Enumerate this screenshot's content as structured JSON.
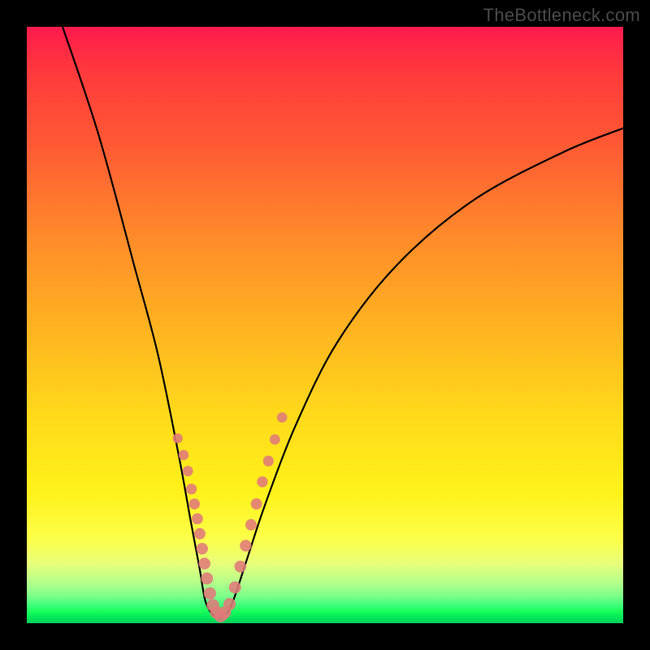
{
  "watermark": "TheBottleneck.com",
  "chart_data": {
    "type": "line",
    "title": "",
    "xlabel": "",
    "ylabel": "",
    "xlim": [
      0,
      1
    ],
    "ylim": [
      0,
      1
    ],
    "series": [
      {
        "name": "bottleneck-curve",
        "points": [
          [
            0.06,
            1.0
          ],
          [
            0.12,
            0.82
          ],
          [
            0.18,
            0.6
          ],
          [
            0.22,
            0.45
          ],
          [
            0.255,
            0.28
          ],
          [
            0.275,
            0.17
          ],
          [
            0.29,
            0.09
          ],
          [
            0.3,
            0.035
          ],
          [
            0.315,
            0.012
          ],
          [
            0.33,
            0.012
          ],
          [
            0.345,
            0.035
          ],
          [
            0.37,
            0.11
          ],
          [
            0.4,
            0.2
          ],
          [
            0.45,
            0.33
          ],
          [
            0.52,
            0.47
          ],
          [
            0.62,
            0.6
          ],
          [
            0.75,
            0.71
          ],
          [
            0.9,
            0.79
          ],
          [
            1.0,
            0.83
          ]
        ]
      },
      {
        "name": "highlight-dots",
        "points": [
          [
            0.253,
            0.31
          ],
          [
            0.263,
            0.282
          ],
          [
            0.27,
            0.255
          ],
          [
            0.276,
            0.225
          ],
          [
            0.281,
            0.2
          ],
          [
            0.286,
            0.175
          ],
          [
            0.29,
            0.15
          ],
          [
            0.294,
            0.125
          ],
          [
            0.298,
            0.1
          ],
          [
            0.302,
            0.075
          ],
          [
            0.307,
            0.05
          ],
          [
            0.312,
            0.03
          ],
          [
            0.318,
            0.018
          ],
          [
            0.325,
            0.012
          ],
          [
            0.332,
            0.018
          ],
          [
            0.34,
            0.032
          ],
          [
            0.349,
            0.06
          ],
          [
            0.358,
            0.095
          ],
          [
            0.367,
            0.13
          ],
          [
            0.376,
            0.165
          ],
          [
            0.385,
            0.2
          ],
          [
            0.395,
            0.237
          ],
          [
            0.405,
            0.272
          ],
          [
            0.416,
            0.308
          ],
          [
            0.428,
            0.345
          ]
        ]
      }
    ]
  }
}
